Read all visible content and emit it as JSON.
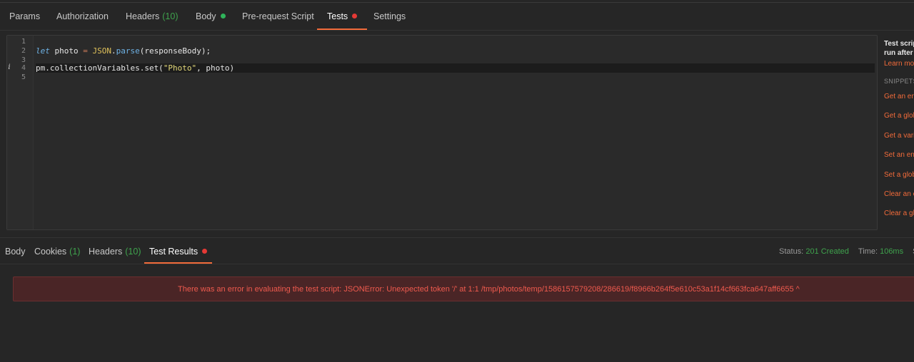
{
  "request_tabs": [
    {
      "label": "Params"
    },
    {
      "label": "Authorization"
    },
    {
      "label": "Headers",
      "count": "(10)"
    },
    {
      "label": "Body"
    },
    {
      "label": "Pre-request Script"
    },
    {
      "label": "Tests"
    },
    {
      "label": "Settings"
    }
  ],
  "editor": {
    "line_numbers": [
      "1",
      "2",
      "3",
      "4",
      "5"
    ],
    "info_marker": "i",
    "line2": {
      "kw": "let",
      "var": " photo ",
      "op": "=",
      "sp": " ",
      "obj": "JSON",
      "dot": ".",
      "fn": "parse",
      "rest": "(responseBody);"
    },
    "line4": {
      "pre": "pm.collectionVariables.set(",
      "str": "\"Photo\"",
      "post": ", photo)"
    }
  },
  "side_panel": {
    "desc_1": "Test script",
    "desc_2": "run after t",
    "learn_more": "Learn mor",
    "snippets_title": "SNIPPETS",
    "snippets": [
      "Get an en",
      "Get a glob",
      "Get a varia",
      "Set an env",
      "Set a glob",
      "Clear an e",
      "Clear a glo"
    ]
  },
  "response_tabs": [
    {
      "label": "Body"
    },
    {
      "label": "Cookies",
      "count": "(1)"
    },
    {
      "label": "Headers",
      "count": "(10)"
    },
    {
      "label": "Test Results"
    }
  ],
  "status": {
    "status_label": "Status:",
    "status_value": "201 Created",
    "time_label": "Time:",
    "time_value": "106ms",
    "size_label": "Si"
  },
  "error": {
    "message": "There was an error in evaluating the test script:  JSONError: Unexpected token '/' at 1:1 /tmp/photos/temp/1586157579208/286619/f8966b264f5e610c53a1f14cf663fca647aff6655 ^"
  },
  "colors": {
    "accent": "#f26b3a",
    "success": "#3fa34d",
    "error_text": "#ef5a4e",
    "error_bg": "#4a2526"
  }
}
